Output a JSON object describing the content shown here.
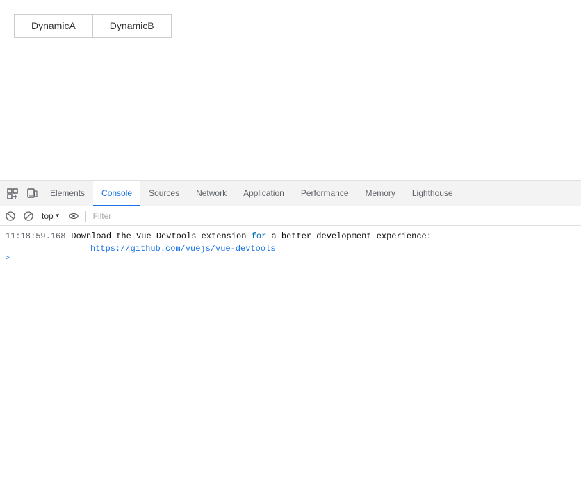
{
  "app": {
    "tabs": [
      {
        "label": "DynamicA",
        "active": false
      },
      {
        "label": "DynamicB",
        "active": false
      }
    ]
  },
  "devtools": {
    "tabs": [
      {
        "label": "Elements",
        "active": false
      },
      {
        "label": "Console",
        "active": true
      },
      {
        "label": "Sources",
        "active": false
      },
      {
        "label": "Network",
        "active": false
      },
      {
        "label": "Application",
        "active": false
      },
      {
        "label": "Performance",
        "active": false
      },
      {
        "label": "Memory",
        "active": false
      },
      {
        "label": "Lighthouse",
        "active": false
      }
    ],
    "toolbar": {
      "context": "top",
      "filter_placeholder": "Filter"
    },
    "console": {
      "timestamp": "11:18:59.168",
      "message_parts": [
        {
          "type": "text",
          "text": "Download the Vue Devtools extension "
        },
        {
          "type": "keyword",
          "text": "for"
        },
        {
          "type": "text",
          "text": " a better development experience:"
        }
      ],
      "link": "https://github.com/vuejs/vue-devtools",
      "expand_arrow": ">"
    }
  }
}
